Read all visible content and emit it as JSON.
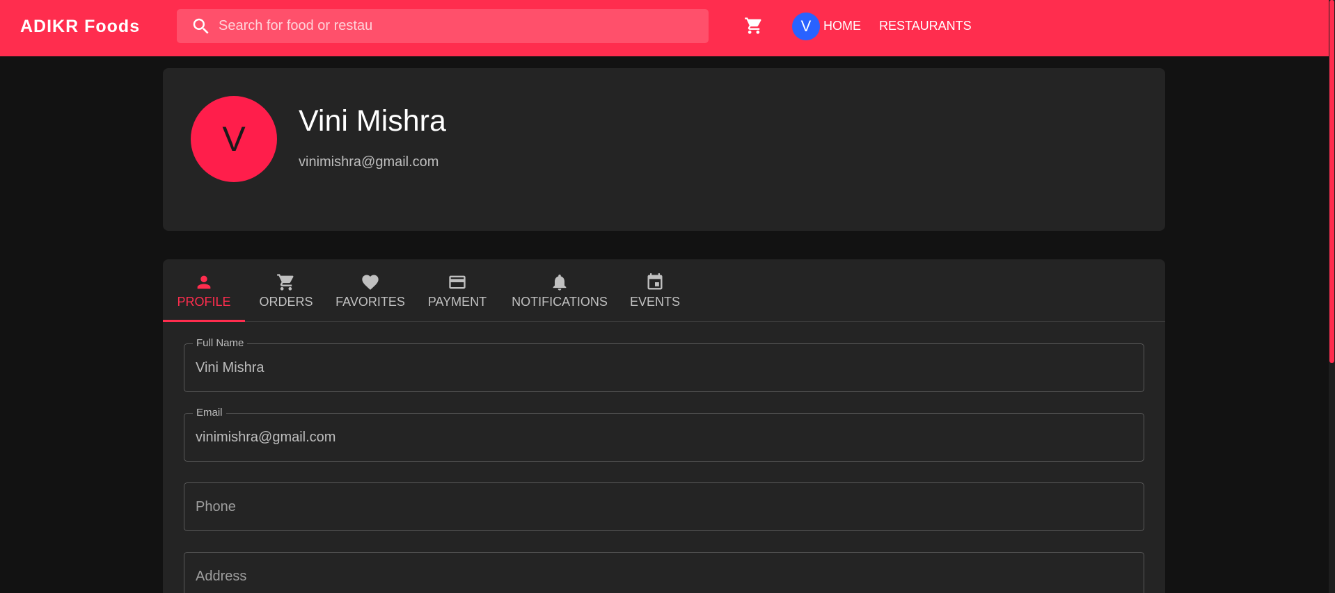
{
  "header": {
    "brand": "ADIKR Foods",
    "search_placeholder": "Search for food or restaurants",
    "cart_icon": "cart-icon",
    "avatar_initial": "V",
    "nav": {
      "home": "HOME",
      "restaurants": "RESTAURANTS"
    }
  },
  "profile": {
    "initial": "V",
    "name": "Vini Mishra",
    "email": "vinimishra@gmail.com"
  },
  "tabs": [
    {
      "label": "PROFILE",
      "icon": "person-icon",
      "active": true
    },
    {
      "label": "ORDERS",
      "icon": "cart-icon",
      "active": false
    },
    {
      "label": "FAVORITES",
      "icon": "heart-icon",
      "active": false
    },
    {
      "label": "PAYMENT",
      "icon": "credit-card-icon",
      "active": false
    },
    {
      "label": "NOTIFICATIONS",
      "icon": "bell-icon",
      "active": false
    },
    {
      "label": "EVENTS",
      "icon": "calendar-icon",
      "active": false
    }
  ],
  "form": {
    "full_name": {
      "label": "Full Name",
      "value": "Vini Mishra"
    },
    "email": {
      "label": "Email",
      "value": "vinimishra@gmail.com"
    },
    "phone": {
      "placeholder": "Phone",
      "value": ""
    },
    "address": {
      "placeholder": "Address",
      "value": ""
    }
  },
  "colors": {
    "accent": "#ff2d4e",
    "avatar_blue": "#2962ff",
    "background": "#121212",
    "card": "#242424"
  }
}
